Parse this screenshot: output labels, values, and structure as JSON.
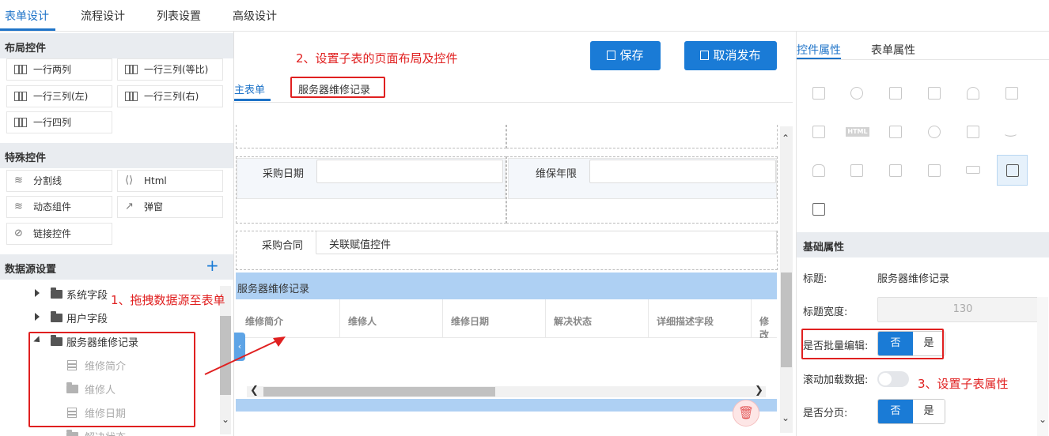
{
  "top_tabs": [
    "表单设计",
    "流程设计",
    "列表设置",
    "高级设计"
  ],
  "layout_section": {
    "title": "布局控件",
    "items": [
      "一行两列",
      "一行三列(等比)",
      "一行三列(左)",
      "一行三列(右)",
      "一行四列"
    ]
  },
  "special_section": {
    "title": "特殊控件",
    "items": [
      "分割线",
      "Html",
      "动态组件",
      "弹窗",
      "链接控件"
    ]
  },
  "datasource_section": {
    "title": "数据源设置",
    "add_icon": "+",
    "tree": {
      "system": "系统字段",
      "user": "用户字段",
      "server": "服务器维修记录",
      "children": [
        "维修简介",
        "维修人",
        "维修日期",
        "解决状态"
      ]
    }
  },
  "annotations": {
    "step1": "1、拖拽数据源至表单",
    "step2": "2、设置子表的页面布局及控件",
    "step3": "3、设置子表属性"
  },
  "toolbar": {
    "save": "保存",
    "unpublish": "取消发布"
  },
  "form_tabs": [
    "主表单",
    "服务器维修记录"
  ],
  "form": {
    "purchase_date_label": "采购日期",
    "warranty_label": "维保年限",
    "contract_label": "采购合同",
    "contract_value": "关联赋值控件",
    "subtable_title": "服务器维修记录",
    "subtable_columns": [
      "维修简介",
      "维修人",
      "维修日期",
      "解决状态",
      "详细描述字段",
      "修改"
    ]
  },
  "right_tabs": [
    "控件属性",
    "表单属性"
  ],
  "right_icons": [
    "doc-icon",
    "link-icon",
    "money-icon",
    "image-icon",
    "user-icon",
    "node-icon",
    "photo-icon",
    "html-icon",
    "barcode-icon",
    "circle-icon",
    "stack-icon",
    "smile-icon",
    "stamp-icon",
    "check-doc-icon",
    "copy-icon",
    "frame-icon",
    "ellipsis-icon",
    "calendar-icon",
    "doc-add-icon"
  ],
  "props": {
    "section_title": "基础属性",
    "title_label": "标题:",
    "title_value": "服务器维修记录",
    "width_label": "标题宽度:",
    "width_value": "130",
    "batch_label": "是否批量编辑:",
    "scroll_label": "滚动加载数据:",
    "paging_label": "是否分页:",
    "no": "否",
    "yes": "是"
  },
  "colors": {
    "accent": "#1a7bd6",
    "annotation": "#e02020",
    "subtable_header": "#aed0f3"
  }
}
